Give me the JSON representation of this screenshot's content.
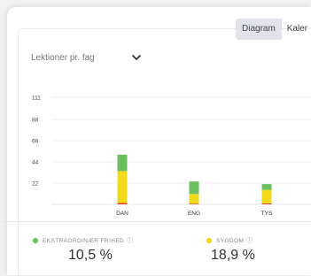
{
  "tabs": [
    {
      "label": "Diagram",
      "active": true
    },
    {
      "label": "Kaler",
      "active": false
    }
  ],
  "dropdown": {
    "label": "Lektioner pr. fag",
    "icon": "chevron-down-icon"
  },
  "chart_data": {
    "type": "bar",
    "stacked": true,
    "categories": [
      "DAN",
      "ENG",
      "TYS"
    ],
    "series": [
      {
        "name": "",
        "color": "#d9442b",
        "values": [
          1.5,
          0.7,
          1.0
        ]
      },
      {
        "name": "Sygdom",
        "color": "#f2da1a",
        "values": [
          33,
          10,
          14
        ]
      },
      {
        "name": "Ekstraordinær frihed",
        "color": "#6cbf5f",
        "values": [
          17,
          13,
          6
        ]
      }
    ],
    "yticks": [
      22,
      44,
      66,
      88,
      111
    ],
    "ylim": [
      0,
      111
    ],
    "grid": true,
    "title": "",
    "xlabel": "",
    "ylabel": ""
  },
  "stats": [
    {
      "label": "EKSTRAORDINÆR FRIHED",
      "value": "10,5 %",
      "color": "#6cbf5f",
      "icon": "info-icon"
    },
    {
      "label": "SYGDOM",
      "value": "18,9 %",
      "color": "#f2da1a",
      "icon": "info-icon"
    }
  ],
  "info_glyph": "ⓘ"
}
